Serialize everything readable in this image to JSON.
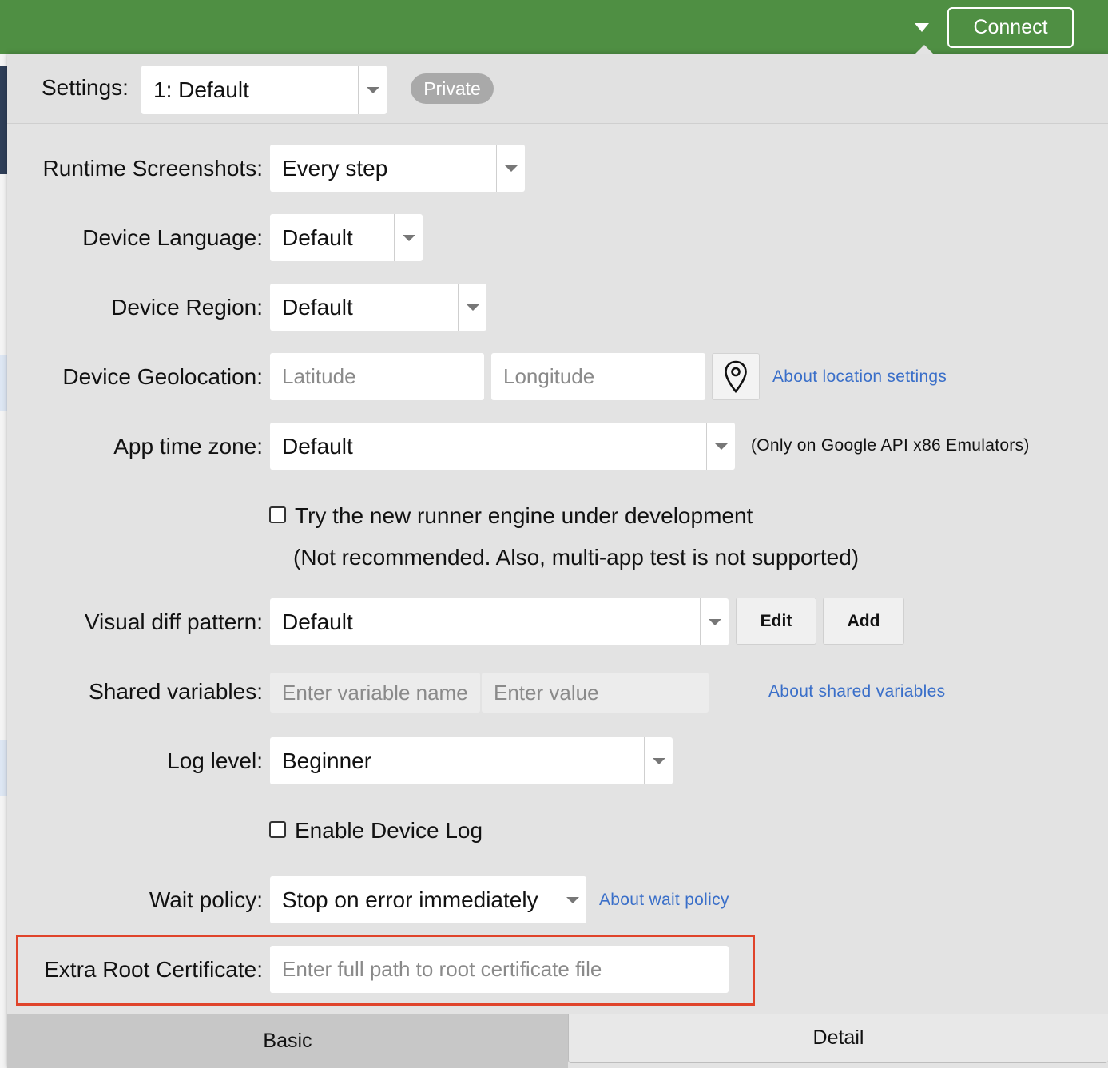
{
  "topbar": {
    "connect_label": "Connect"
  },
  "header": {
    "settings_label": "Settings:",
    "settings_value": "1: Default",
    "badge": "Private"
  },
  "form": {
    "runtime_screenshots": {
      "label": "Runtime Screenshots:",
      "value": "Every step"
    },
    "device_language": {
      "label": "Device Language:",
      "value": "Default"
    },
    "device_region": {
      "label": "Device Region:",
      "value": "Default"
    },
    "device_geolocation": {
      "label": "Device Geolocation:",
      "latitude_placeholder": "Latitude",
      "longitude_placeholder": "Longitude",
      "link": "About location settings"
    },
    "app_time_zone": {
      "label": "App time zone:",
      "value": "Default",
      "note": "(Only on Google API x86 Emulators)"
    },
    "new_runner": {
      "label": "Try the new runner engine under development",
      "note": "(Not recommended. Also, multi-app test is not supported)",
      "checked": false
    },
    "visual_diff": {
      "label": "Visual diff pattern:",
      "value": "Default",
      "edit_label": "Edit",
      "add_label": "Add"
    },
    "shared_variables": {
      "label": "Shared variables:",
      "name_placeholder": "Enter variable name",
      "value_placeholder": "Enter value",
      "link": "About shared variables"
    },
    "log_level": {
      "label": "Log level:",
      "value": "Beginner"
    },
    "device_log": {
      "label": "Enable Device Log",
      "checked": false
    },
    "wait_policy": {
      "label": "Wait policy:",
      "value": "Stop on error immediately",
      "link": "About wait policy"
    },
    "extra_root_cert": {
      "label": "Extra Root Certificate:",
      "placeholder": "Enter full path to root certificate file"
    }
  },
  "tabs": [
    {
      "label": "Basic",
      "active": true
    },
    {
      "label": "Detail",
      "active": false
    }
  ],
  "colors": {
    "topbar": "#4f8f43",
    "link": "#3a6fc9",
    "highlight": "#e0442b",
    "panel": "#e3e3e3"
  }
}
